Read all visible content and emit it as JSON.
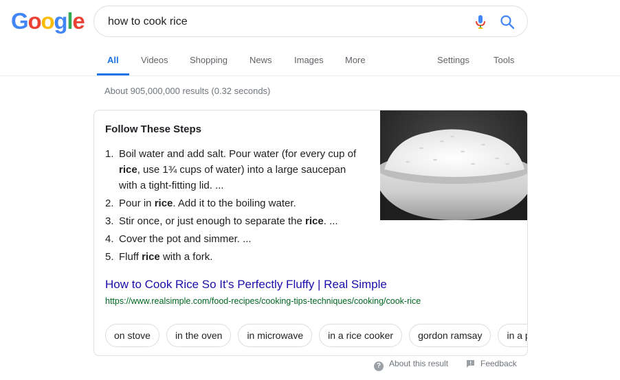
{
  "logo": {
    "letters": [
      "G",
      "o",
      "o",
      "g",
      "l",
      "e"
    ],
    "colors": [
      "#4285f4",
      "#ea4335",
      "#fbbc05",
      "#4285f4",
      "#34a853",
      "#ea4335"
    ]
  },
  "search": {
    "query": "how to cook rice",
    "icons": [
      "mic-icon",
      "search-icon"
    ]
  },
  "tabs": {
    "items": [
      {
        "label": "All",
        "active": true
      },
      {
        "label": "Videos"
      },
      {
        "label": "Shopping"
      },
      {
        "label": "News"
      },
      {
        "label": "Images"
      },
      {
        "label": "More"
      },
      {
        "label": "Settings"
      },
      {
        "label": "Tools"
      }
    ],
    "accent_color": "#1a73e8"
  },
  "result_stats": "About 905,000,000 results (0.32 seconds)",
  "featured_snippet": {
    "title": "Follow These Steps",
    "steps": [
      {
        "num": "1.",
        "parts": [
          "Boil water and add salt. Pour water (for every cup of ",
          "rice",
          ", use 1¾ cups of water) into a large saucepan with a tight-fitting lid. ..."
        ]
      },
      {
        "num": "2.",
        "parts": [
          "Pour in ",
          "rice",
          ". Add it to the boiling water."
        ]
      },
      {
        "num": "3.",
        "parts": [
          "Stir once, or just enough to separate the ",
          "rice",
          ". ..."
        ]
      },
      {
        "num": "4.",
        "parts": [
          "Cover the pot and simmer. ..."
        ]
      },
      {
        "num": "5.",
        "parts": [
          "Fluff ",
          "rice",
          " with a fork."
        ]
      }
    ],
    "link_title": "How to Cook Rice So It's Perfectly Fluffy | Real Simple",
    "link_url": "https://www.realsimple.com/food-recipes/cooking-tips-techniques/cooking/cook-rice",
    "link_color": "#1a0dab",
    "url_color": "#006621",
    "chips": [
      "on stove",
      "in the oven",
      "in microwave",
      "in a rice cooker",
      "gordon ramsay",
      "in a pr"
    ]
  },
  "footer": {
    "about": "About this result",
    "feedback": "Feedback"
  }
}
